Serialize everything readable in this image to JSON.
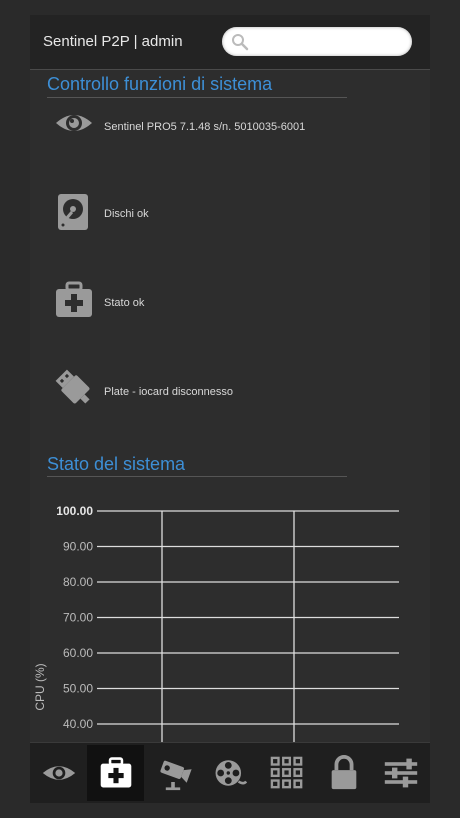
{
  "header": {
    "title": "Sentinel P2P | admin",
    "search_placeholder": ""
  },
  "sections": {
    "system_functions": "Controllo funzioni di sistema",
    "system_status": "Stato del sistema"
  },
  "status_items": [
    {
      "icon": "eye-icon",
      "label": "Sentinel PRO5 7.1.48 s/n. 5010035-6001"
    },
    {
      "icon": "hard-disk-icon",
      "label": "Dischi ok"
    },
    {
      "icon": "first-aid-kit-icon",
      "label": "Stato ok"
    },
    {
      "icon": "usb-plug-icon",
      "label": "Plate - iocard disconnesso"
    }
  ],
  "chart_data": {
    "type": "line",
    "ylabel": "CPU (%)",
    "xlabel": "",
    "ylim": [
      40,
      100
    ],
    "y_ticks": [
      "100.00",
      "90.00",
      "80.00",
      "70.00",
      "60.00",
      "50.00",
      "40.00"
    ],
    "grid": true,
    "series": []
  },
  "tabs": [
    {
      "icon": "eye-icon",
      "active": false
    },
    {
      "icon": "first-aid-kit-icon",
      "active": true
    },
    {
      "icon": "camera-icon",
      "active": false
    },
    {
      "icon": "film-reel-icon",
      "active": false
    },
    {
      "icon": "grid-icon",
      "active": false
    },
    {
      "icon": "lock-icon",
      "active": false
    },
    {
      "icon": "sliders-icon",
      "active": false
    }
  ],
  "colors": {
    "accent": "#3d8fd6",
    "background": "#2d2d2d",
    "icon": "#9a9a9a"
  }
}
